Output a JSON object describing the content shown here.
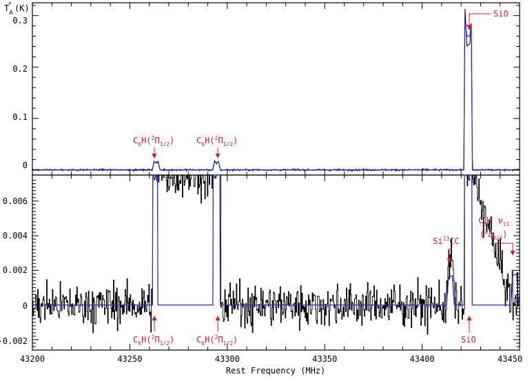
{
  "chart_data": [
    {
      "type": "line",
      "panel": "top",
      "ylabel": "T",
      "ylabel_sub": "A",
      "ylabel_sup": "*",
      "ylabel_unit": "(K)",
      "xlim": [
        43200,
        43450
      ],
      "ylim": [
        -0.01,
        0.325
      ],
      "yticks": [
        0,
        0.1,
        0.2,
        0.3
      ],
      "ytick_labels": [
        "0",
        "0.1",
        "0.2",
        "0.3"
      ],
      "colors": {
        "observed": "#000000",
        "model": "#1f2fd8",
        "annotation": "#e8161c"
      },
      "series": [
        {
          "role": "observed",
          "x": [
            43200,
            43261.5,
            43262.5,
            43263.5,
            43264.5,
            43265.5,
            43292.5,
            43293.5,
            43294.5,
            43295.5,
            43296.5,
            43421.4,
            43421.9,
            43423.0,
            43424.5,
            43425.2,
            43425.8,
            43450
          ],
          "y": [
            0,
            0,
            0.017,
            0.013,
            0.017,
            0,
            0,
            0.017,
            0.012,
            0.017,
            0,
            0,
            0.32,
            0.24,
            0.245,
            0.29,
            0,
            0
          ]
        },
        {
          "role": "model",
          "x": [
            43200,
            43261.5,
            43262.5,
            43263.5,
            43264.5,
            43265.5,
            43292.5,
            43293.5,
            43294.5,
            43295.5,
            43296.5,
            43421.4,
            43421.9,
            43423.0,
            43424.5,
            43425.2,
            43425.8,
            43450
          ],
          "y": [
            0,
            0,
            0.016,
            0.014,
            0.016,
            0,
            0,
            0.016,
            0.013,
            0.016,
            0,
            0,
            0.29,
            0.26,
            0.26,
            0.285,
            0,
            0
          ]
        }
      ],
      "annotations": [
        {
          "text": "SiO",
          "x": 43423,
          "y": 0.28
        },
        {
          "base": "C",
          "base_sub": "6",
          "mid": "H(",
          "sup": "2",
          "greek": "Π",
          "greek_sub": "1/2",
          "close": ")",
          "x": 43263,
          "y": 0.017
        },
        {
          "base": "C",
          "base_sub": "6",
          "mid": "H(",
          "sup": "2",
          "greek": "Π",
          "greek_sub": "1/2",
          "close": ")",
          "x": 43294,
          "y": 0.017
        }
      ]
    },
    {
      "type": "line",
      "panel": "bottom",
      "xlabel": "Rest Frequency (MHz)",
      "xlim": [
        43200,
        43450
      ],
      "ylim": [
        -0.0026,
        0.0075
      ],
      "xticks": [
        43200,
        43250,
        43300,
        43350,
        43400,
        43450
      ],
      "xtick_labels": [
        "43200",
        "43250",
        "43300",
        "43350",
        "43400",
        "43450"
      ],
      "yticks": [
        -0.002,
        0,
        0.002,
        0.004,
        0.006
      ],
      "ytick_labels": [
        "-0.002",
        "0",
        "0.002",
        "0.004",
        "0.006"
      ],
      "noise_rms": 0.0006,
      "series": [
        {
          "role": "observed",
          "note_shape": "noise plus lines",
          "x": [
            43261.6,
            43264.4,
            43292.6,
            43296.4,
            43412.5,
            43413.5,
            43415.5,
            43416.5,
            43421.5,
            43425.7,
            43445.5,
            43446.5,
            43448.5,
            43449.5
          ],
          "y": [
            0.0075,
            0.0075,
            0.0075,
            0.0075,
            0.0002,
            0.0025,
            0.0025,
            0.0002,
            0.0075,
            0.0075,
            0.0002,
            0.002,
            0.002,
            0.0002
          ]
        },
        {
          "role": "model",
          "x": [
            43200,
            43261.6,
            43261.8,
            43264.2,
            43264.4,
            43292.6,
            43292.8,
            43296.2,
            43296.4,
            43412.5,
            43413.5,
            43415.5,
            43416.5,
            43421.5,
            43421.7,
            43425.5,
            43425.7,
            43445.5,
            43446.5,
            43448.5,
            43449.5,
            43450
          ],
          "y": [
            0,
            0,
            0.0075,
            0.0075,
            0,
            0,
            0.0075,
            0.0075,
            0,
            0,
            0.0016,
            0.0017,
            0,
            0,
            0.0075,
            0.0075,
            0,
            0,
            0.0017,
            0.0018,
            0,
            0
          ]
        }
      ],
      "annotations": [
        {
          "text": "Si",
          "sup": "13",
          "rest": "CC",
          "x": 43414,
          "y": 0.0025
        },
        {
          "line1_base": "C",
          "line1_sub": "6",
          "line1_mid": "H",
          "line1_greek": "ν",
          "line1_greek_sub": "11",
          "line2_open": "(",
          "line2_sup": "2",
          "line2_greek": "Δ",
          "line2_sub": "3/2",
          "line2_close": ")",
          "x": 43447,
          "y": 0.0025
        },
        {
          "text": "SiO",
          "x": 43423,
          "y": -0.0006
        },
        {
          "base": "C",
          "base_sub": "6",
          "mid": "H(",
          "sup": "2",
          "greek": "Π",
          "greek_sub": "1/2",
          "close": ")",
          "x": 43263,
          "y": -0.0006
        },
        {
          "base": "C",
          "base_sub": "6",
          "mid": "H(",
          "sup": "2",
          "greek": "Π",
          "greek_sub": "1/2",
          "close": ")",
          "x": 43294,
          "y": -0.0006
        }
      ]
    }
  ]
}
